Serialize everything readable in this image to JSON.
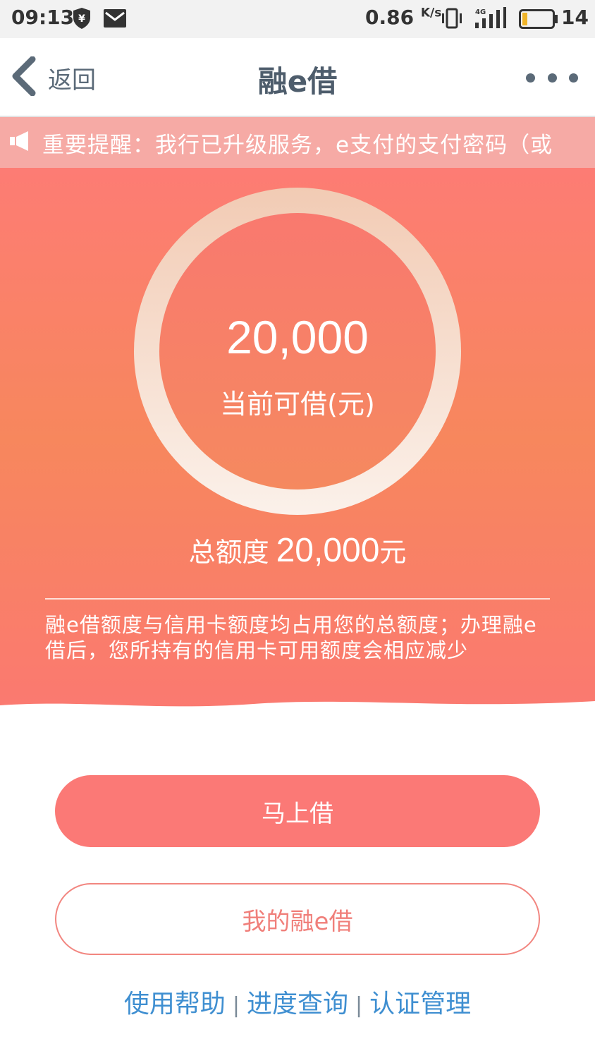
{
  "status_bar": {
    "time": "09:13",
    "speed": "0.86",
    "speed_unit": "K/s",
    "network": "4G",
    "battery": "14",
    "icons": [
      "yuan-shield-icon",
      "mail-icon",
      "vibrate-icon",
      "signal-icon",
      "battery-icon"
    ]
  },
  "nav": {
    "back_label": "返回",
    "title": "融e借",
    "more_icon": "more-dots-icon"
  },
  "notice": {
    "text": "重要提醒：我行已升级服务，e支付的支付密码（或",
    "icon": "speaker-icon"
  },
  "loan": {
    "available_amount": "20,000",
    "available_label": "当前可借(元)",
    "total_label": "总额度",
    "total_amount": "20,000",
    "total_unit": "元",
    "note": "融e借额度与信用卡额度均占用您的总额度；办理融e借后，您所持有的信用卡可用额度会相应减少"
  },
  "actions": {
    "borrow_now": "马上借",
    "my_loan": "我的融e借"
  },
  "footer": {
    "help": "使用帮助",
    "progress": "进度查询",
    "certification": "认证管理",
    "separator": "|"
  },
  "colors": {
    "primary": "#fb7976",
    "hero_top": "#fd7c74",
    "hero_mid": "#f7875d",
    "link": "#3f8fd1",
    "nav_text": "#4e5d6c"
  }
}
